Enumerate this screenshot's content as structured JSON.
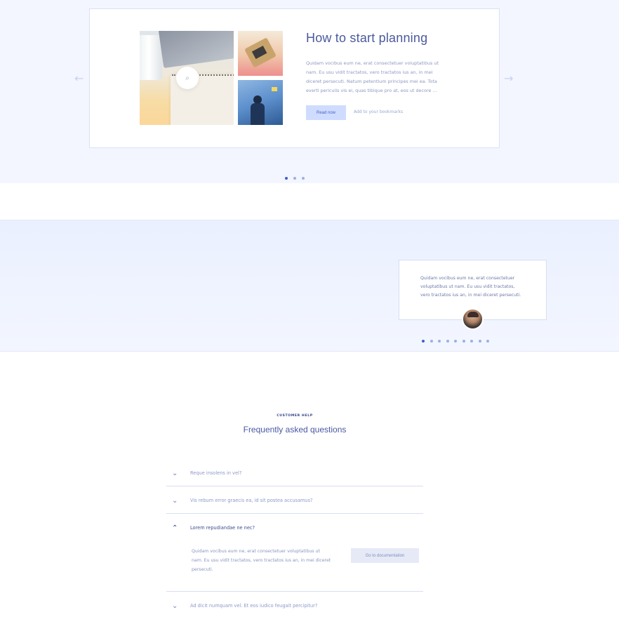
{
  "hero": {
    "title": "How to start planning",
    "text": "Quidam vocibus eum ne, erat consectetuer voluptatibus ut nam. Eu usu vidit tractatos, vero tractatos ius an, in mei diceret persecuti. Natum petentium principes mei ea. Tota everti periculis vis ei, quas tibique pro at, eos ut decore ...",
    "read_button": "Read now",
    "bookmark_link": "Add to your bookmarks",
    "prev_arrow": "←",
    "next_arrow": "→",
    "search_icon": "⌕",
    "slides_count": 3,
    "active_slide": 1
  },
  "testimonial": {
    "text": "Quidam vocibus eum ne, erat consectetuer voluptatibus ut nam. Eu usu vidit tractatos, vero tractatos ius an, in mei diceret persecuti.",
    "slides_count": 9,
    "active_slide": 1
  },
  "faq": {
    "eyebrow": "CUSTOMER HELP",
    "title": "Frequently asked questions",
    "items": [
      {
        "question": "Reque insolens in vel?",
        "open": false
      },
      {
        "question": "Vis rebum error graecis ea, id sit postea accusamus?",
        "open": false
      },
      {
        "question": "Lorem repudiandae ne nec?",
        "open": true
      },
      {
        "question": "Ad dicit numquam vel. Et eos iudico feugait percipitur?",
        "open": false
      }
    ],
    "answer": "Quidam vocibus eum ne, erat consectetuer voluptatibus ut nam. Eu usu vidit tractatos, vero tractatos ius an, in mei diceret persecuti.",
    "docs_button": "Go to documentation",
    "chevron_closed": "⌄",
    "chevron_open": "⌃"
  },
  "colors": {
    "accent": "#3f5fcc",
    "hero_bg": "#f3f6ff",
    "button_bg": "#cfdcff"
  }
}
